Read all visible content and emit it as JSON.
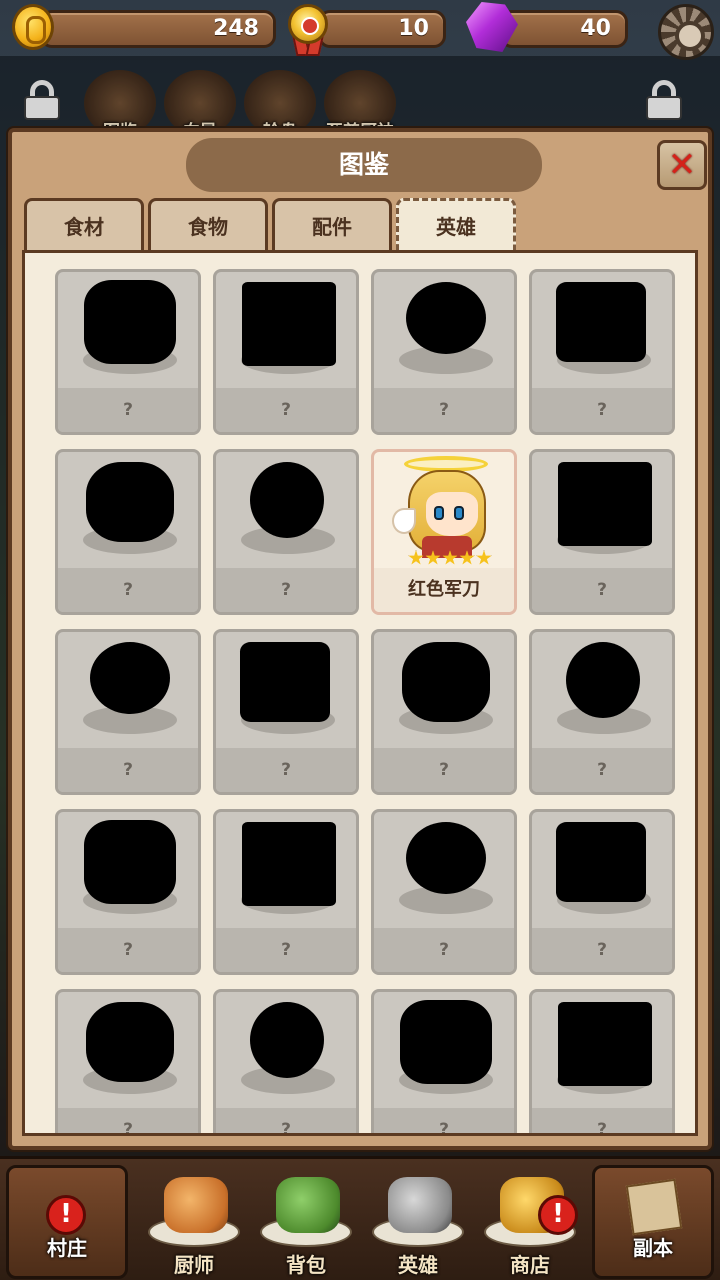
{
  "resources": {
    "coins": "248",
    "medals": "10",
    "gems": "40"
  },
  "menu_row": {
    "items": [
      "图鉴",
      "向导",
      "轮盘",
      "至尊厨神"
    ]
  },
  "panel": {
    "title": "图鉴",
    "tabs": [
      {
        "label": "食材",
        "active": false
      },
      {
        "label": "食物",
        "active": false
      },
      {
        "label": "配件",
        "active": false
      },
      {
        "label": "英雄",
        "active": true
      }
    ]
  },
  "heroes": {
    "cards": [
      {
        "name": "?",
        "unlocked": false
      },
      {
        "name": "?",
        "unlocked": false
      },
      {
        "name": "?",
        "unlocked": false
      },
      {
        "name": "?",
        "unlocked": false
      },
      {
        "name": "?",
        "unlocked": false
      },
      {
        "name": "?",
        "unlocked": false
      },
      {
        "name": "红色军刀",
        "unlocked": true,
        "stars": 5
      },
      {
        "name": "?",
        "unlocked": false
      },
      {
        "name": "?",
        "unlocked": false
      },
      {
        "name": "?",
        "unlocked": false
      },
      {
        "name": "?",
        "unlocked": false
      },
      {
        "name": "?",
        "unlocked": false
      },
      {
        "name": "?",
        "unlocked": false
      },
      {
        "name": "?",
        "unlocked": false
      },
      {
        "name": "?",
        "unlocked": false
      },
      {
        "name": "?",
        "unlocked": false
      },
      {
        "name": "?",
        "unlocked": false
      },
      {
        "name": "?",
        "unlocked": false
      },
      {
        "name": "?",
        "unlocked": false
      },
      {
        "name": "?",
        "unlocked": false
      }
    ]
  },
  "bottom_nav": {
    "village": "村庄",
    "chef": "厨师",
    "bag": "背包",
    "hero": "英雄",
    "shop": "商店",
    "dungeon": "副本",
    "badge_symbol": "!"
  },
  "colors": {
    "panel_bg": "#c9a27a",
    "content_bg": "#f4ecdc",
    "close_x": "#d4221a",
    "star": "#f6c21c",
    "badge": "#d9221c"
  }
}
